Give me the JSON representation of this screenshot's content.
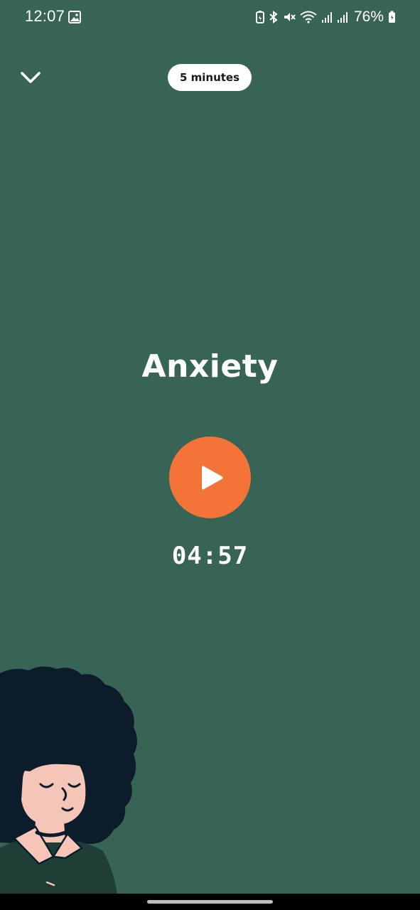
{
  "status_bar": {
    "time": "12:07",
    "battery_percent": "76%",
    "icons": [
      "image-icon",
      "battery-saver-icon",
      "bluetooth-icon",
      "mute-icon",
      "wifi-icon",
      "signal-icon",
      "signal-icon",
      "battery-icon"
    ]
  },
  "header": {
    "collapse_icon": "chevron-down-icon",
    "duration_label": "5 minutes"
  },
  "session": {
    "title": "Anxiety",
    "play_icon": "play-icon",
    "timer": "04:57"
  },
  "colors": {
    "background": "#386456",
    "accent": "#f47339",
    "text": "#ffffff"
  }
}
